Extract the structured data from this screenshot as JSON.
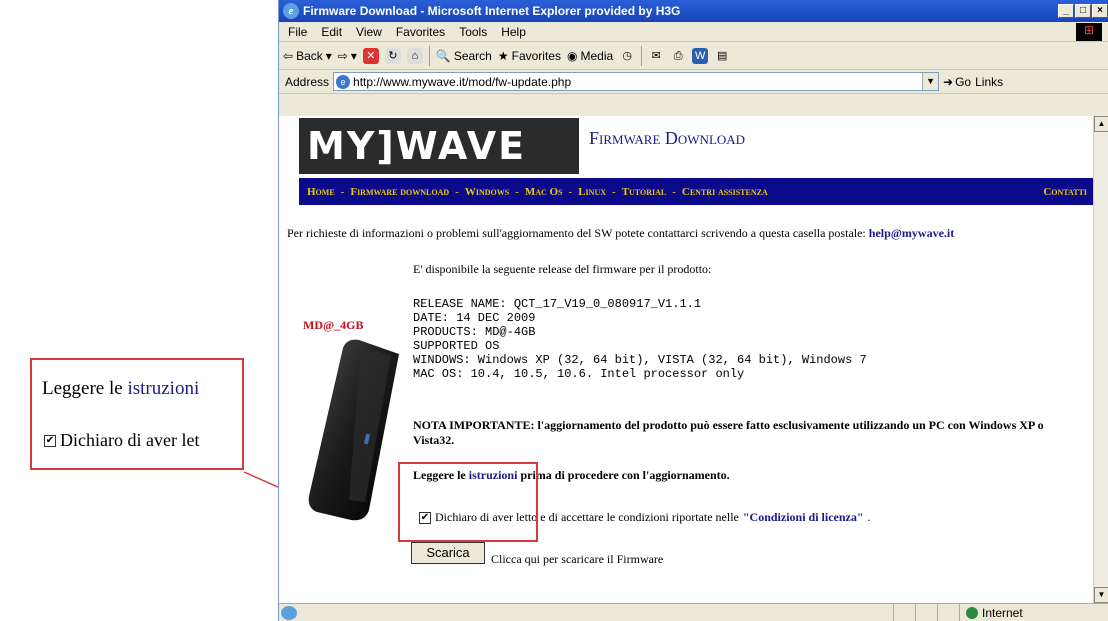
{
  "window": {
    "title": "Firmware Download - Microsoft Internet Explorer provided by H3G",
    "controls": [
      "_",
      "□",
      "×"
    ]
  },
  "menu": [
    "File",
    "Edit",
    "View",
    "Favorites",
    "Tools",
    "Help"
  ],
  "toolbar": {
    "back": "Back",
    "search": "Search",
    "favorites": "Favorites",
    "media": "Media"
  },
  "address": {
    "label": "Address",
    "url": "http://www.mywave.it/mod/fw-update.php",
    "go": "Go",
    "links": "Links"
  },
  "page": {
    "logo": "MY]WAVE",
    "site_title": "Firmware Download",
    "nav": [
      "Home",
      "Firmware download",
      "Windows",
      "Mac Os",
      "Linux",
      "Tutorial",
      "Centri assistenza"
    ],
    "nav_right": "Contatti",
    "info_text": "Per richieste di informazioni o problemi sull'aggiornamento del SW potete contattarci scrivendo a questa casella postale: ",
    "info_email": "help@mywave.it",
    "available": "E' disponibile la seguente release del firmware per il prodotto:",
    "product_label": "MD@_4GB",
    "release_lines": [
      "RELEASE NAME: QCT_17_V19_0_080917_V1.1.1",
      "DATE: 14 DEC 2009",
      "PRODUCTS: MD@-4GB",
      "SUPPORTED OS",
      "WINDOWS: Windows XP (32, 64 bit), VISTA (32, 64 bit), Windows 7",
      "MAC OS: 10.4, 10.5, 10.6. Intel processor only"
    ],
    "nota": "NOTA IMPORTANTE: l'aggiornamento del prodotto può essere fatto esclusivamente utilizzando un PC con Windows XP o Vista32.",
    "leggere_pre": "Leggere le ",
    "leggere_link": "istruzioni",
    "leggere_post": " prima di procedere con l'aggiornamento.",
    "dichiaro_text": "Dichiaro di aver letto e di accettare le condizioni riportate nelle ",
    "license_link": "\"Condizioni di licenza\"",
    "dichiaro_end": ".",
    "download_button": "Scarica",
    "download_text": "Clicca qui per scaricare il Firmware"
  },
  "callout": {
    "line1_pre": "Leggere le ",
    "line1_link": "istruzioni",
    "line2": "Dichiaro di aver let"
  },
  "status": {
    "zone": "Internet"
  }
}
